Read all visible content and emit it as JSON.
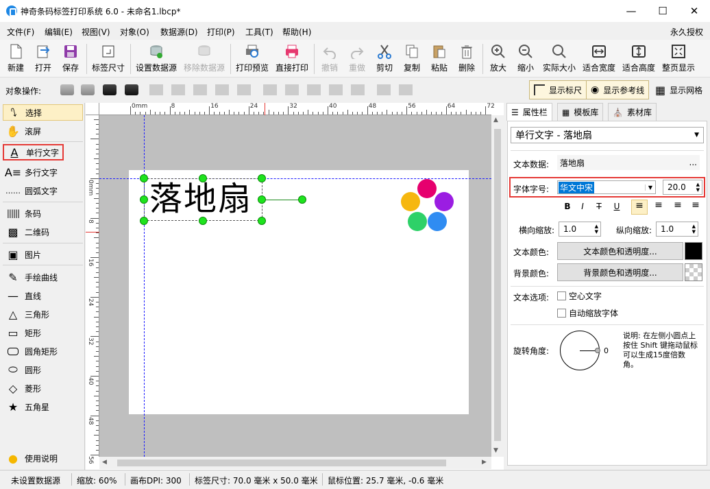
{
  "window": {
    "title": "神奇条码标签打印系统 6.0 - 未命名1.lbcp*"
  },
  "menu": [
    "文件(F)",
    "编辑(E)",
    "视图(V)",
    "对象(O)",
    "数据源(D)",
    "打印(P)",
    "工具(T)",
    "帮助(H)"
  ],
  "license": "永久授权",
  "toolbar": {
    "new": "新建",
    "open": "打开",
    "save": "保存",
    "label_size": "标签尺寸",
    "set_datasource": "设置数据源",
    "remove_datasource": "移除数据源",
    "print_preview": "打印预览",
    "direct_print": "直接打印",
    "undo": "撤销",
    "redo": "重做",
    "cut": "剪切",
    "copy": "复制",
    "paste": "粘贴",
    "delete": "删除",
    "zoom_in": "放大",
    "zoom_out": "缩小",
    "actual_size": "实际大小",
    "fit_width": "适合宽度",
    "fit_height": "适合高度",
    "full_page": "整页显示"
  },
  "objbar": {
    "label": "对象操作:",
    "show_ruler": "显示标尺",
    "show_guides": "显示参考线",
    "show_grid": "显示网格"
  },
  "tools": {
    "select": "选择",
    "scroll": "滚屏",
    "single_text": "单行文字",
    "multi_text": "多行文字",
    "arc_text": "圆弧文字",
    "barcode": "条码",
    "qrcode": "二维码",
    "image": "图片",
    "freehand": "手绘曲线",
    "line": "直线",
    "triangle": "三角形",
    "rect": "矩形",
    "round_rect": "圆角矩形",
    "ellipse": "圆形",
    "diamond": "菱形",
    "star": "五角星",
    "help": "使用说明"
  },
  "ruler": {
    "top": [
      "0mm",
      "8",
      "16",
      "24",
      "32",
      "40",
      "48",
      "56",
      "64",
      "72"
    ],
    "left": [
      "0mm",
      "8",
      "16",
      "24",
      "32",
      "40",
      "48",
      "56"
    ]
  },
  "canvas": {
    "text": "落地扇"
  },
  "panel": {
    "tabs": [
      "属性栏",
      "模板库",
      "素材库"
    ],
    "object_select": "单行文字 - 落地扇",
    "text_data_label": "文本数据:",
    "text_data_value": "落地扇",
    "more": "...",
    "font_label": "字体字号:",
    "font_value": "华文中宋",
    "font_size": "20.0",
    "h_scale_label": "横向缩放:",
    "h_scale": "1.0",
    "v_scale_label": "纵向缩放:",
    "v_scale": "1.0",
    "text_color_label": "文本颜色:",
    "text_color_btn": "文本颜色和透明度...",
    "bg_color_label": "背景颜色:",
    "bg_color_btn": "背景颜色和透明度...",
    "text_options_label": "文本选项:",
    "hollow": "空心文字",
    "auto_scale": "自动缩放字体",
    "rotate_label": "旋转角度:",
    "rotate_value": "0",
    "rotate_note": "说明: 在左侧小圆点上按住 Shift 键拖动鼠标可以生成15度倍数角。"
  },
  "status": {
    "datasource": "未设置数据源",
    "zoom": "缩放: 60%",
    "dpi": "画布DPI: 300",
    "label_size": "标签尺寸: 70.0 毫米 x 50.0 毫米",
    "mouse": "鼠标位置: 25.7 毫米, -0.6 毫米"
  },
  "colors": {
    "accent_red": "#e53935",
    "handle_green": "#1ee31e",
    "guide_blue": "#1a1aff"
  }
}
